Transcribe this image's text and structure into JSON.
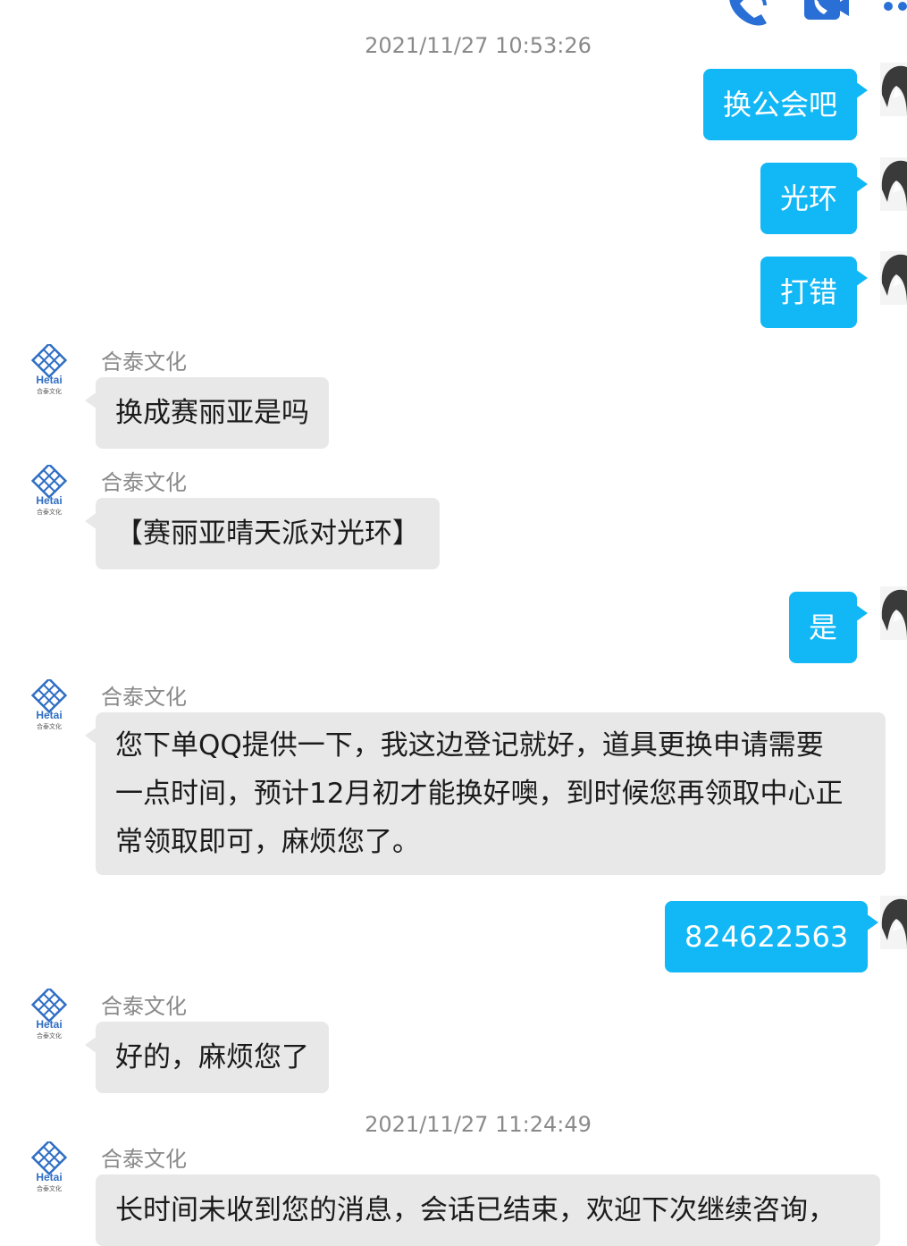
{
  "colors": {
    "outgoing_bubble": "#12b7f5",
    "incoming_bubble": "#e8e8e8",
    "timestamp_text": "#8a8a8a",
    "toolbar_icon": "#2a6fd6"
  },
  "header": {
    "icons": [
      "phone-call-icon",
      "video-call-icon",
      "more-icon"
    ]
  },
  "chat": {
    "timestamp_1": "2021/11/27 10:53:26",
    "out_1": "换公会吧",
    "out_2": "光环",
    "out_3": "打错",
    "in_1": {
      "sender": "合泰文化",
      "text": "换成赛丽亚是吗"
    },
    "in_2": {
      "sender": "合泰文化",
      "text": "【赛丽亚晴天派对光环】"
    },
    "out_4": "是",
    "in_3": {
      "sender": "合泰文化",
      "line1": "您下单QQ提供一下，我这边登记就好，道具更换申请需要",
      "line2": "一点时间，预计12月初才能换好噢，到时候您再领取中心正",
      "line3": "常领取即可，麻烦您了。"
    },
    "out_5": "824622563",
    "in_4": {
      "sender": "合泰文化",
      "text": "好的，麻烦您了"
    },
    "timestamp_2": "2021/11/27 11:24:49",
    "in_5": {
      "sender": "合泰文化",
      "text": "长时间未收到您的消息，会话已结束，欢迎下次继续咨询，"
    }
  },
  "avatar": {
    "brand_text": "Hetai",
    "brand_sub": "合泰文化"
  }
}
